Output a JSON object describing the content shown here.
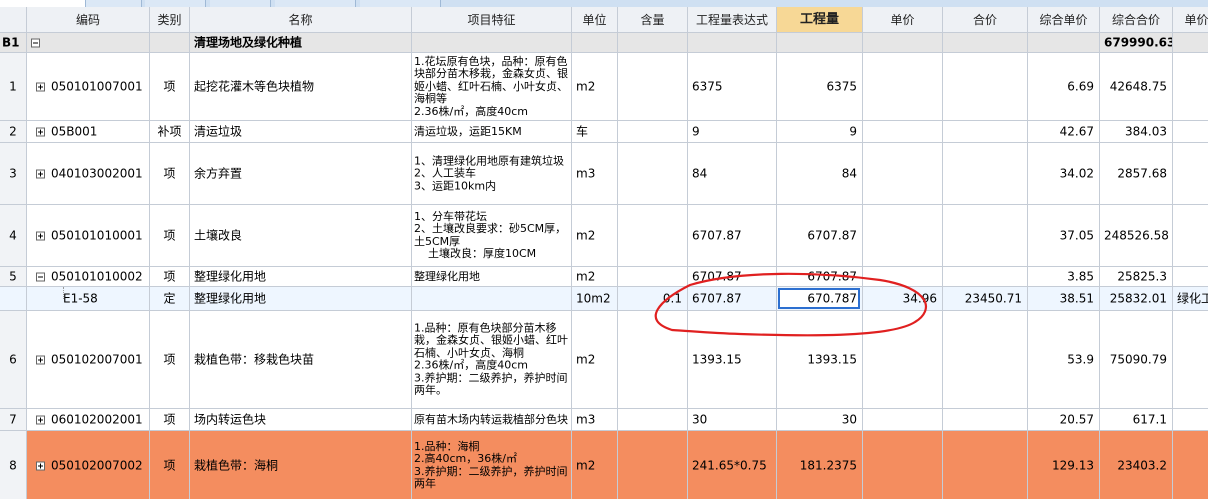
{
  "header": {
    "code": "编码",
    "category": "类别",
    "name": "名称",
    "feature": "项目特征",
    "unit": "单位",
    "content": "含量",
    "qty_expr": "工程量表达式",
    "qty": "工程量",
    "unit_price": "单价",
    "total": "合价",
    "comp_unit_price": "综合单价",
    "comp_total": "综合合价",
    "extra": "单价构"
  },
  "section": {
    "id": "B1",
    "name": "清理场地及绿化种植",
    "comp_total": "679990.63"
  },
  "rows": [
    {
      "no": "1",
      "code": "050101007001",
      "category": "项",
      "name": "起挖花灌木等色块植物",
      "feature": "1.花坛原有色块，品种：原有色块部分苗木移栽，金森女贞、银姬小蜡、红叶石楠、小叶女贞、海桐等\n2.36株/㎡，高度40cm",
      "unit": "m2",
      "content": "",
      "qty_expr": "6375",
      "qty": "6375",
      "unit_price": "",
      "total": "",
      "comp_unit_price": "6.69",
      "comp_total": "42648.75"
    },
    {
      "no": "2",
      "code": "05B001",
      "category": "补项",
      "name": "清运垃圾",
      "feature": "清运垃圾，运距15KM",
      "unit": "车",
      "content": "",
      "qty_expr": "9",
      "qty": "9",
      "unit_price": "",
      "total": "",
      "comp_unit_price": "42.67",
      "comp_total": "384.03"
    },
    {
      "no": "3",
      "code": "040103002001",
      "category": "项",
      "name": "余方弃置",
      "feature": "1、清理绿化用地原有建筑垃圾\n2、人工装车\n3、运距10km内",
      "unit": "m3",
      "content": "",
      "qty_expr": "84",
      "qty": "84",
      "unit_price": "",
      "total": "",
      "comp_unit_price": "34.02",
      "comp_total": "2857.68"
    },
    {
      "no": "4",
      "code": "050101010001",
      "category": "项",
      "name": "土壤改良",
      "feature": "1、分车带花坛\n2、土壤改良要求：砂5CM厚，土5CM厚\n    土壤改良：厚度10CM",
      "unit": "m2",
      "content": "",
      "qty_expr": "6707.87",
      "qty": "6707.87",
      "unit_price": "",
      "total": "",
      "comp_unit_price": "37.05",
      "comp_total": "248526.58"
    },
    {
      "no": "5",
      "code": "050101010002",
      "category": "项",
      "name": "整理绿化用地",
      "feature": "整理绿化用地",
      "unit": "m2",
      "content": "",
      "qty_expr": "6707.87",
      "qty": "6707.87",
      "unit_price": "",
      "total": "",
      "comp_unit_price": "3.85",
      "comp_total": "25825.3"
    },
    {
      "no": "",
      "code": "E1-58",
      "category": "定",
      "name": "整理绿化用地",
      "feature": "",
      "unit": "10m2",
      "content": "0.1",
      "qty_expr": "6707.87",
      "qty": "670.787",
      "unit_price": "34.96",
      "total": "23450.71",
      "comp_unit_price": "38.51",
      "comp_total": "25832.01",
      "extra": "绿化工"
    },
    {
      "no": "6",
      "code": "050102007001",
      "category": "项",
      "name": "栽植色带：移栽色块苗",
      "feature": "1.品种：原有色块部分苗木移栽，金森女贞、银姬小蜡、红叶石楠、小叶女贞、海桐\n2.36株/㎡，高度40cm\n3.养护期：二级养护，养护时间两年。",
      "unit": "m2",
      "content": "",
      "qty_expr": "1393.15",
      "qty": "1393.15",
      "unit_price": "",
      "total": "",
      "comp_unit_price": "53.9",
      "comp_total": "75090.79"
    },
    {
      "no": "7",
      "code": "060102002001",
      "category": "项",
      "name": "场内转运色块",
      "feature": "原有苗木场内转运栽植部分色块",
      "unit": "m3",
      "content": "",
      "qty_expr": "30",
      "qty": "30",
      "unit_price": "",
      "total": "",
      "comp_unit_price": "20.57",
      "comp_total": "617.1"
    },
    {
      "no": "8",
      "code": "050102007002",
      "category": "项",
      "name": "栽植色带：海桐",
      "feature": "1.品种：海桐\n2.高40cm，36株/㎡\n3.养护期：二级养护，养护时间两年",
      "unit": "m2",
      "content": "",
      "qty_expr": "241.65*0.75",
      "qty": "181.2375",
      "unit_price": "",
      "total": "",
      "comp_unit_price": "129.13",
      "comp_total": "23403.2"
    }
  ],
  "colors": {
    "header_highlight": "#f7d896",
    "orange_row": "#f48d5f",
    "selection": "#2c6fd0",
    "annotation": "#e02020"
  }
}
